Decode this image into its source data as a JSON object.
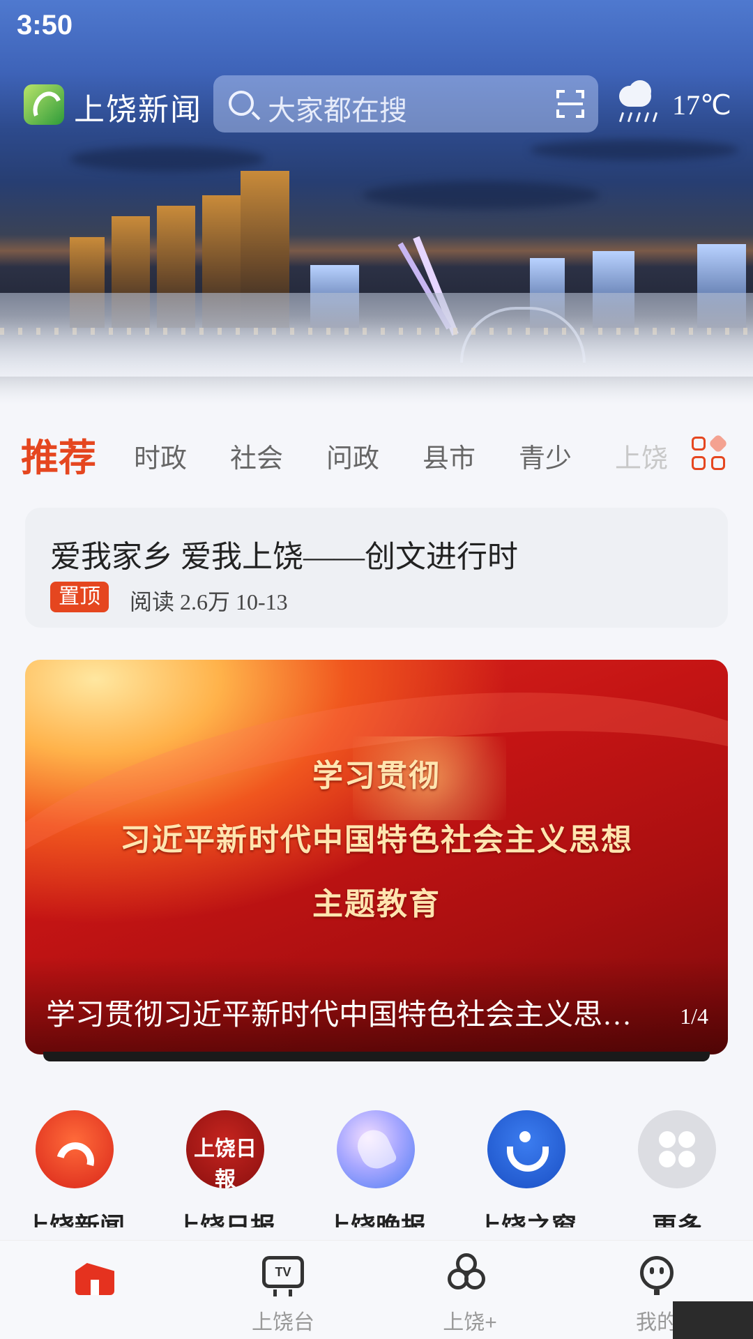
{
  "status_bar": {
    "time": "3:50"
  },
  "header": {
    "app_name": "上饶新闻",
    "search_placeholder": "大家都在搜",
    "weather": {
      "icon": "rain-cloud-icon",
      "temperature": "17℃"
    }
  },
  "tabs": [
    {
      "label": "推荐",
      "active": true
    },
    {
      "label": "时政"
    },
    {
      "label": "社会"
    },
    {
      "label": "问政"
    },
    {
      "label": "县市"
    },
    {
      "label": "青少"
    },
    {
      "label": "上饶"
    }
  ],
  "pinned": {
    "title": "爱我家乡 爱我上饶——创文进行时",
    "badge": "置顶",
    "meta": "阅读 2.6万  10-13"
  },
  "banner": {
    "line1": "学习贯彻",
    "line2": "习近平新时代中国特色社会主义思想",
    "line3": "主题教育",
    "caption": "学习贯彻习近平新时代中国特色社会主义思想主题教育",
    "pager": "1/4"
  },
  "quick_links": [
    {
      "label": "上饶新闻网"
    },
    {
      "label": "上饶日报",
      "icon_text": "上饶日報"
    },
    {
      "label": "上饶晚报"
    },
    {
      "label": "上饶之窗"
    },
    {
      "label": "更多"
    }
  ],
  "bottom_nav": [
    {
      "label": "",
      "icon": "home-icon",
      "active": true
    },
    {
      "label": "上饶台",
      "icon": "tv-icon",
      "icon_text": "TV"
    },
    {
      "label": "上饶+",
      "icon": "three-circles-icon"
    },
    {
      "label": "我的",
      "icon": "profile-icon"
    }
  ],
  "colors": {
    "accent": "#e5461f",
    "banner_red": "#c41414"
  }
}
